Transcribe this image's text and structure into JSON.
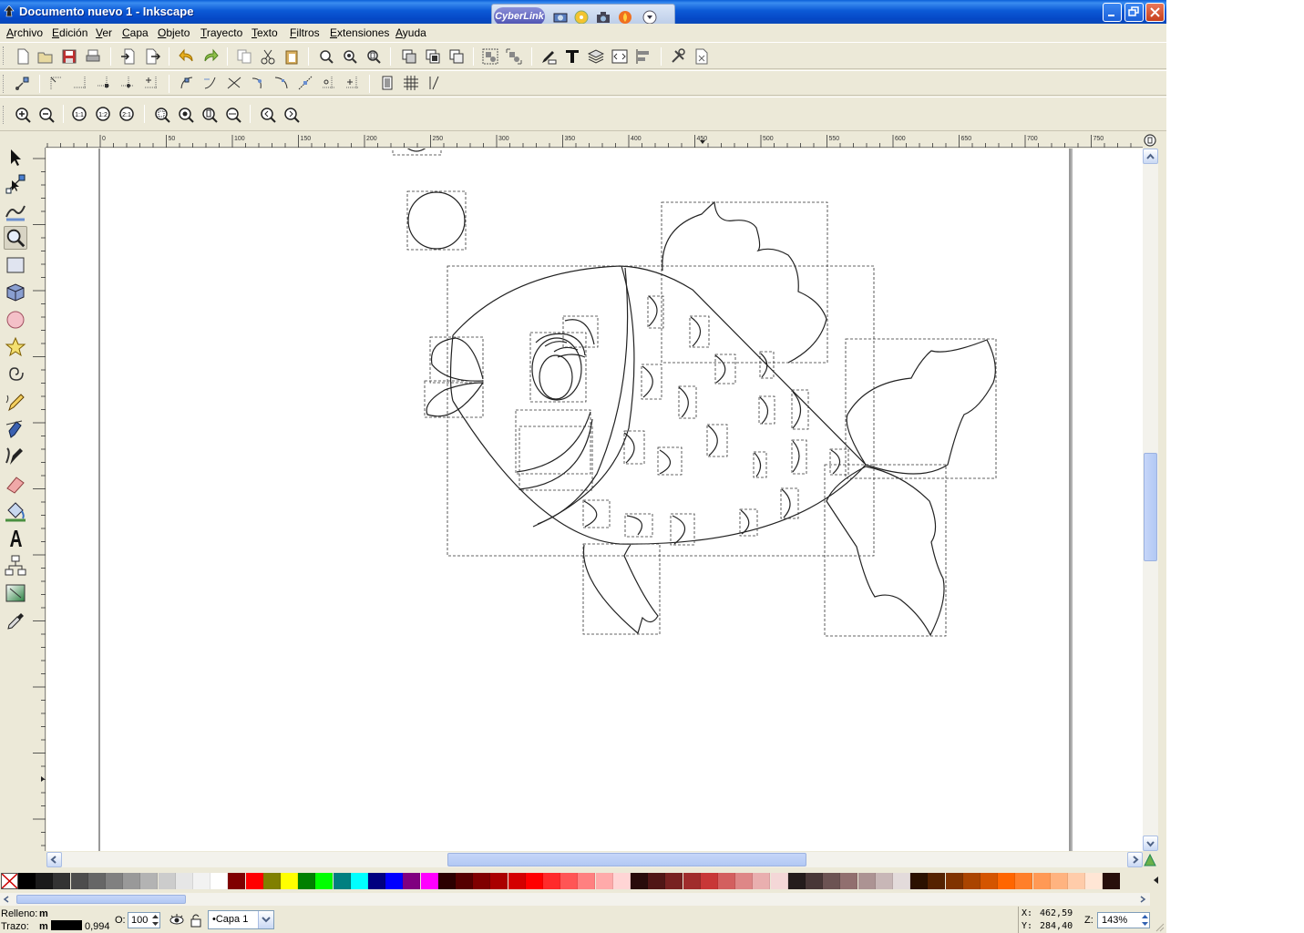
{
  "window": {
    "title": "Documento nuevo 1 - Inkscape",
    "cyberlink_label": "CyberLink"
  },
  "menu": [
    "Archivo",
    "Edición",
    "Ver",
    "Capa",
    "Objeto",
    "Trayecto",
    "Texto",
    "Filtros",
    "Extensiones",
    "Ayuda"
  ],
  "zoom_toolbar": {
    "zoom_1_1": "1:1",
    "zoom_1_2": "1:2",
    "zoom_2_1": "2:1"
  },
  "ruler": {
    "top_ticks": [
      "0",
      "50",
      "100",
      "150",
      "200",
      "250",
      "300",
      "350",
      "400",
      "450",
      "500",
      "550",
      "600",
      "650",
      "700",
      "750"
    ]
  },
  "tools": [
    "selector-tool",
    "node-tool",
    "tweak-tool",
    "zoom-tool",
    "rectangle-tool",
    "3d-box-tool",
    "ellipse-tool",
    "star-tool",
    "spiral-tool",
    "pencil-tool",
    "pen-tool",
    "calligraphy-tool",
    "eraser-tool",
    "paint-bucket-tool",
    "text-tool",
    "connector-tool",
    "gradient-tool",
    "dropper-tool"
  ],
  "palette": {
    "colors": [
      "#000000",
      "#1a1a1a",
      "#333333",
      "#4d4d4d",
      "#666666",
      "#808080",
      "#999999",
      "#b3b3b3",
      "#cccccc",
      "#e6e6e6",
      "#f2f2f2",
      "#ffffff",
      "#800000",
      "#ff0000",
      "#808000",
      "#ffff00",
      "#008000",
      "#00ff00",
      "#008080",
      "#00ffff",
      "#000080",
      "#0000ff",
      "#800080",
      "#ff00ff",
      "#2b0000",
      "#550000",
      "#800000",
      "#aa0000",
      "#d40000",
      "#ff0000",
      "#ff2a2a",
      "#ff5555",
      "#ff8080",
      "#ffaaaa",
      "#ffd5d5",
      "#280b0b",
      "#501616",
      "#782121",
      "#a02c2c",
      "#c83737",
      "#d35f5f",
      "#de8787",
      "#e9afaf",
      "#f4d7d7",
      "#241c1c",
      "#483737",
      "#6c5353",
      "#916f6f",
      "#ac9393",
      "#c8b7b7",
      "#e3dbdb",
      "#2b1100",
      "#552200",
      "#803300",
      "#aa4400",
      "#d45500",
      "#ff6600",
      "#ff7f2a",
      "#ff9955",
      "#ffb380",
      "#ffccaa",
      "#ffe6d5",
      "#280f0b"
    ]
  },
  "status": {
    "fill_label": "Relleno:",
    "fill_value": "m",
    "stroke_label": "Trazo:",
    "stroke_value": "m",
    "stroke_width": "0,994",
    "opacity_label": "O:",
    "opacity_value": "100",
    "layer": "•Capa 1",
    "x_label": "X:",
    "x_value": "462,59",
    "y_label": "Y:",
    "y_value": "284,40",
    "zoom_label": "Z:",
    "zoom_value": "143%"
  }
}
